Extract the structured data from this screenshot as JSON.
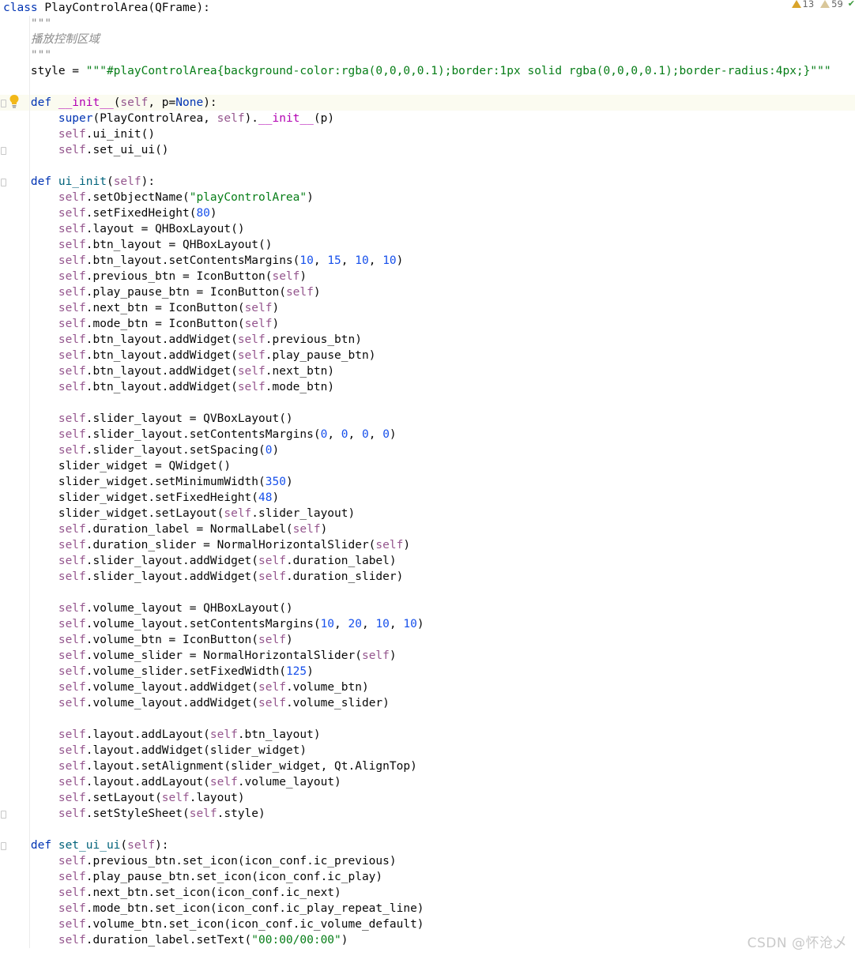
{
  "editor": {
    "lines": [
      [
        [
          "class ",
          "kw"
        ],
        [
          "PlayControlArea(QFrame):",
          ""
        ]
      ],
      [
        [
          "    \"\"\"",
          "doc"
        ]
      ],
      [
        [
          "    播放控制区域",
          "doc"
        ]
      ],
      [
        [
          "    \"\"\"",
          "doc"
        ]
      ],
      [
        [
          "    style = ",
          ""
        ],
        [
          "\"\"\"#playControlArea{background-color:rgba(0,0,0,0.1);border:1px solid rgba(0,0,0,0.1);border-radius:4px;}\"\"\"",
          "str"
        ]
      ],
      [
        [
          "",
          ""
        ]
      ],
      [
        [
          "    ",
          ""
        ],
        [
          "def ",
          "kw"
        ],
        [
          "__init__",
          "dunder"
        ],
        [
          "(",
          ""
        ],
        [
          "self",
          "self"
        ],
        [
          ", p=",
          ""
        ],
        [
          "None",
          "kw"
        ],
        [
          "):",
          ""
        ]
      ],
      [
        [
          "        ",
          ""
        ],
        [
          "super",
          "kw"
        ],
        [
          "(PlayControlArea, ",
          ""
        ],
        [
          "self",
          "self"
        ],
        [
          ").",
          ""
        ],
        [
          "__init__",
          "dunder"
        ],
        [
          "(p)",
          ""
        ]
      ],
      [
        [
          "        ",
          ""
        ],
        [
          "self",
          "self"
        ],
        [
          ".ui_init()",
          ""
        ]
      ],
      [
        [
          "        ",
          ""
        ],
        [
          "self",
          "self"
        ],
        [
          ".set_ui_ui()",
          ""
        ]
      ],
      [
        [
          "",
          ""
        ]
      ],
      [
        [
          "    ",
          ""
        ],
        [
          "def ",
          "kw"
        ],
        [
          "ui_init",
          "fn"
        ],
        [
          "(",
          ""
        ],
        [
          "self",
          "self"
        ],
        [
          "):",
          ""
        ]
      ],
      [
        [
          "        ",
          ""
        ],
        [
          "self",
          "self"
        ],
        [
          ".setObjectName(",
          ""
        ],
        [
          "\"playControlArea\"",
          "str"
        ],
        [
          ")",
          ""
        ]
      ],
      [
        [
          "        ",
          ""
        ],
        [
          "self",
          "self"
        ],
        [
          ".setFixedHeight(",
          ""
        ],
        [
          "80",
          "num"
        ],
        [
          ")",
          ""
        ]
      ],
      [
        [
          "        ",
          ""
        ],
        [
          "self",
          "self"
        ],
        [
          ".layout = QHBoxLayout()",
          ""
        ]
      ],
      [
        [
          "        ",
          ""
        ],
        [
          "self",
          "self"
        ],
        [
          ".btn_layout = QHBoxLayout()",
          ""
        ]
      ],
      [
        [
          "        ",
          ""
        ],
        [
          "self",
          "self"
        ],
        [
          ".btn_layout.setContentsMargins(",
          ""
        ],
        [
          "10",
          "num"
        ],
        [
          ", ",
          ""
        ],
        [
          "15",
          "num"
        ],
        [
          ", ",
          ""
        ],
        [
          "10",
          "num"
        ],
        [
          ", ",
          ""
        ],
        [
          "10",
          "num"
        ],
        [
          ")",
          ""
        ]
      ],
      [
        [
          "        ",
          ""
        ],
        [
          "self",
          "self"
        ],
        [
          ".previous_btn = IconButton(",
          ""
        ],
        [
          "self",
          "self"
        ],
        [
          ")",
          ""
        ]
      ],
      [
        [
          "        ",
          ""
        ],
        [
          "self",
          "self"
        ],
        [
          ".play_pause_btn = IconButton(",
          ""
        ],
        [
          "self",
          "self"
        ],
        [
          ")",
          ""
        ]
      ],
      [
        [
          "        ",
          ""
        ],
        [
          "self",
          "self"
        ],
        [
          ".next_btn = IconButton(",
          ""
        ],
        [
          "self",
          "self"
        ],
        [
          ")",
          ""
        ]
      ],
      [
        [
          "        ",
          ""
        ],
        [
          "self",
          "self"
        ],
        [
          ".mode_btn = IconButton(",
          ""
        ],
        [
          "self",
          "self"
        ],
        [
          ")",
          ""
        ]
      ],
      [
        [
          "        ",
          ""
        ],
        [
          "self",
          "self"
        ],
        [
          ".btn_layout.addWidget(",
          ""
        ],
        [
          "self",
          "self"
        ],
        [
          ".previous_btn)",
          ""
        ]
      ],
      [
        [
          "        ",
          ""
        ],
        [
          "self",
          "self"
        ],
        [
          ".btn_layout.addWidget(",
          ""
        ],
        [
          "self",
          "self"
        ],
        [
          ".play_pause_btn)",
          ""
        ]
      ],
      [
        [
          "        ",
          ""
        ],
        [
          "self",
          "self"
        ],
        [
          ".btn_layout.addWidget(",
          ""
        ],
        [
          "self",
          "self"
        ],
        [
          ".next_btn)",
          ""
        ]
      ],
      [
        [
          "        ",
          ""
        ],
        [
          "self",
          "self"
        ],
        [
          ".btn_layout.addWidget(",
          ""
        ],
        [
          "self",
          "self"
        ],
        [
          ".mode_btn)",
          ""
        ]
      ],
      [
        [
          "",
          ""
        ]
      ],
      [
        [
          "        ",
          ""
        ],
        [
          "self",
          "self"
        ],
        [
          ".slider_layout = QVBoxLayout()",
          ""
        ]
      ],
      [
        [
          "        ",
          ""
        ],
        [
          "self",
          "self"
        ],
        [
          ".slider_layout.setContentsMargins(",
          ""
        ],
        [
          "0",
          "num"
        ],
        [
          ", ",
          ""
        ],
        [
          "0",
          "num"
        ],
        [
          ", ",
          ""
        ],
        [
          "0",
          "num"
        ],
        [
          ", ",
          ""
        ],
        [
          "0",
          "num"
        ],
        [
          ")",
          ""
        ]
      ],
      [
        [
          "        ",
          ""
        ],
        [
          "self",
          "self"
        ],
        [
          ".slider_layout.setSpacing(",
          ""
        ],
        [
          "0",
          "num"
        ],
        [
          ")",
          ""
        ]
      ],
      [
        [
          "        slider_widget = QWidget()",
          ""
        ]
      ],
      [
        [
          "        slider_widget.setMinimumWidth(",
          ""
        ],
        [
          "350",
          "num"
        ],
        [
          ")",
          ""
        ]
      ],
      [
        [
          "        slider_widget.setFixedHeight(",
          ""
        ],
        [
          "48",
          "num"
        ],
        [
          ")",
          ""
        ]
      ],
      [
        [
          "        slider_widget.setLayout(",
          ""
        ],
        [
          "self",
          "self"
        ],
        [
          ".slider_layout)",
          ""
        ]
      ],
      [
        [
          "        ",
          ""
        ],
        [
          "self",
          "self"
        ],
        [
          ".duration_label = NormalLabel(",
          ""
        ],
        [
          "self",
          "self"
        ],
        [
          ")",
          ""
        ]
      ],
      [
        [
          "        ",
          ""
        ],
        [
          "self",
          "self"
        ],
        [
          ".duration_slider = NormalHorizontalSlider(",
          ""
        ],
        [
          "self",
          "self"
        ],
        [
          ")",
          ""
        ]
      ],
      [
        [
          "        ",
          ""
        ],
        [
          "self",
          "self"
        ],
        [
          ".slider_layout.addWidget(",
          ""
        ],
        [
          "self",
          "self"
        ],
        [
          ".duration_label)",
          ""
        ]
      ],
      [
        [
          "        ",
          ""
        ],
        [
          "self",
          "self"
        ],
        [
          ".slider_layout.addWidget(",
          ""
        ],
        [
          "self",
          "self"
        ],
        [
          ".duration_slider)",
          ""
        ]
      ],
      [
        [
          "",
          ""
        ]
      ],
      [
        [
          "        ",
          ""
        ],
        [
          "self",
          "self"
        ],
        [
          ".volume_layout = QHBoxLayout()",
          ""
        ]
      ],
      [
        [
          "        ",
          ""
        ],
        [
          "self",
          "self"
        ],
        [
          ".volume_layout.setContentsMargins(",
          ""
        ],
        [
          "10",
          "num"
        ],
        [
          ", ",
          ""
        ],
        [
          "20",
          "num"
        ],
        [
          ", ",
          ""
        ],
        [
          "10",
          "num"
        ],
        [
          ", ",
          ""
        ],
        [
          "10",
          "num"
        ],
        [
          ")",
          ""
        ]
      ],
      [
        [
          "        ",
          ""
        ],
        [
          "self",
          "self"
        ],
        [
          ".volume_btn = IconButton(",
          ""
        ],
        [
          "self",
          "self"
        ],
        [
          ")",
          ""
        ]
      ],
      [
        [
          "        ",
          ""
        ],
        [
          "self",
          "self"
        ],
        [
          ".volume_slider = NormalHorizontalSlider(",
          ""
        ],
        [
          "self",
          "self"
        ],
        [
          ")",
          ""
        ]
      ],
      [
        [
          "        ",
          ""
        ],
        [
          "self",
          "self"
        ],
        [
          ".volume_slider.setFixedWidth(",
          ""
        ],
        [
          "125",
          "num"
        ],
        [
          ")",
          ""
        ]
      ],
      [
        [
          "        ",
          ""
        ],
        [
          "self",
          "self"
        ],
        [
          ".volume_layout.addWidget(",
          ""
        ],
        [
          "self",
          "self"
        ],
        [
          ".volume_btn)",
          ""
        ]
      ],
      [
        [
          "        ",
          ""
        ],
        [
          "self",
          "self"
        ],
        [
          ".volume_layout.addWidget(",
          ""
        ],
        [
          "self",
          "self"
        ],
        [
          ".volume_slider)",
          ""
        ]
      ],
      [
        [
          "",
          ""
        ]
      ],
      [
        [
          "        ",
          ""
        ],
        [
          "self",
          "self"
        ],
        [
          ".layout.addLayout(",
          ""
        ],
        [
          "self",
          "self"
        ],
        [
          ".btn_layout)",
          ""
        ]
      ],
      [
        [
          "        ",
          ""
        ],
        [
          "self",
          "self"
        ],
        [
          ".layout.addWidget(slider_widget)",
          ""
        ]
      ],
      [
        [
          "        ",
          ""
        ],
        [
          "self",
          "self"
        ],
        [
          ".layout.setAlignment(slider_widget, Qt.AlignTop)",
          ""
        ]
      ],
      [
        [
          "        ",
          ""
        ],
        [
          "self",
          "self"
        ],
        [
          ".layout.addLayout(",
          ""
        ],
        [
          "self",
          "self"
        ],
        [
          ".volume_layout)",
          ""
        ]
      ],
      [
        [
          "        ",
          ""
        ],
        [
          "self",
          "self"
        ],
        [
          ".setLayout(",
          ""
        ],
        [
          "self",
          "self"
        ],
        [
          ".layout)",
          ""
        ]
      ],
      [
        [
          "        ",
          ""
        ],
        [
          "self",
          "self"
        ],
        [
          ".setStyleSheet(",
          ""
        ],
        [
          "self",
          "self"
        ],
        [
          ".style)",
          ""
        ]
      ],
      [
        [
          "",
          ""
        ]
      ],
      [
        [
          "    ",
          ""
        ],
        [
          "def ",
          "kw"
        ],
        [
          "set_ui_ui",
          "fn"
        ],
        [
          "(",
          ""
        ],
        [
          "self",
          "self"
        ],
        [
          "):",
          ""
        ]
      ],
      [
        [
          "        ",
          ""
        ],
        [
          "self",
          "self"
        ],
        [
          ".previous_btn.set_icon(icon_conf.ic_previous)",
          ""
        ]
      ],
      [
        [
          "        ",
          ""
        ],
        [
          "self",
          "self"
        ],
        [
          ".play_pause_btn.set_icon(icon_conf.ic_play)",
          ""
        ]
      ],
      [
        [
          "        ",
          ""
        ],
        [
          "self",
          "self"
        ],
        [
          ".next_btn.set_icon(icon_conf.ic_next)",
          ""
        ]
      ],
      [
        [
          "        ",
          ""
        ],
        [
          "self",
          "self"
        ],
        [
          ".mode_btn.set_icon(icon_conf.ic_play_repeat_line)",
          ""
        ]
      ],
      [
        [
          "        ",
          ""
        ],
        [
          "self",
          "self"
        ],
        [
          ".volume_btn.set_icon(icon_conf.ic_volume_default)",
          ""
        ]
      ],
      [
        [
          "        ",
          ""
        ],
        [
          "self",
          "self"
        ],
        [
          ".duration_label.setText(",
          ""
        ],
        [
          "\"00:00/00:00\"",
          "str"
        ],
        [
          ")",
          ""
        ]
      ]
    ],
    "highlighted_line": 6,
    "fold_markers": [
      6,
      9,
      11,
      51,
      53
    ]
  },
  "inspections": {
    "warnings": "13",
    "weak_warnings": "59",
    "warning_icon": "warning-triangle-icon",
    "weak_warning_icon": "weak-warning-triangle-icon",
    "status_icon": "check-icon"
  },
  "intention_icon": "lightbulb-icon",
  "watermark": "CSDN @怀沧乄",
  "colors": {
    "keyword": "#0033b3",
    "self": "#94558d",
    "number": "#1750eb",
    "string": "#067d17",
    "docstring": "#8c8c8c",
    "dunder": "#b200b2",
    "function": "#00627a"
  }
}
